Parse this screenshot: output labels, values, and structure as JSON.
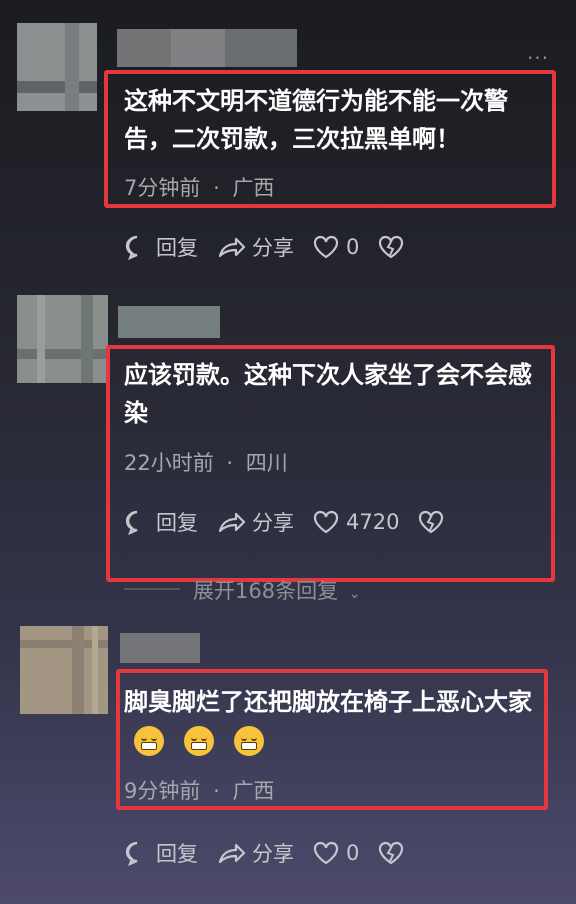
{
  "comments": [
    {
      "text": "这种不文明不道德行为能不能一次警告，二次罚款，三次拉黑单啊！",
      "time": "7分钟前",
      "location": "广西",
      "reply_label": "回复",
      "share_label": "分享",
      "like_count": "0"
    },
    {
      "text": "应该罚款。这种下次人家坐了会不会感染",
      "time": "22小时前",
      "location": "四川",
      "reply_label": "回复",
      "share_label": "分享",
      "like_count": "4720"
    },
    {
      "text": "脚臭脚烂了还把脚放在椅子上恶心大家",
      "time": "9分钟前",
      "location": "广西",
      "reply_label": "回复",
      "share_label": "分享",
      "like_count": "0"
    }
  ],
  "meta_separator": "·",
  "expand_replies": "展开168条回复",
  "more_menu": "···",
  "colors": {
    "highlight": "#e5383e",
    "background": "#25262e",
    "text": "#ffffff",
    "meta": "#a6a7ad"
  }
}
